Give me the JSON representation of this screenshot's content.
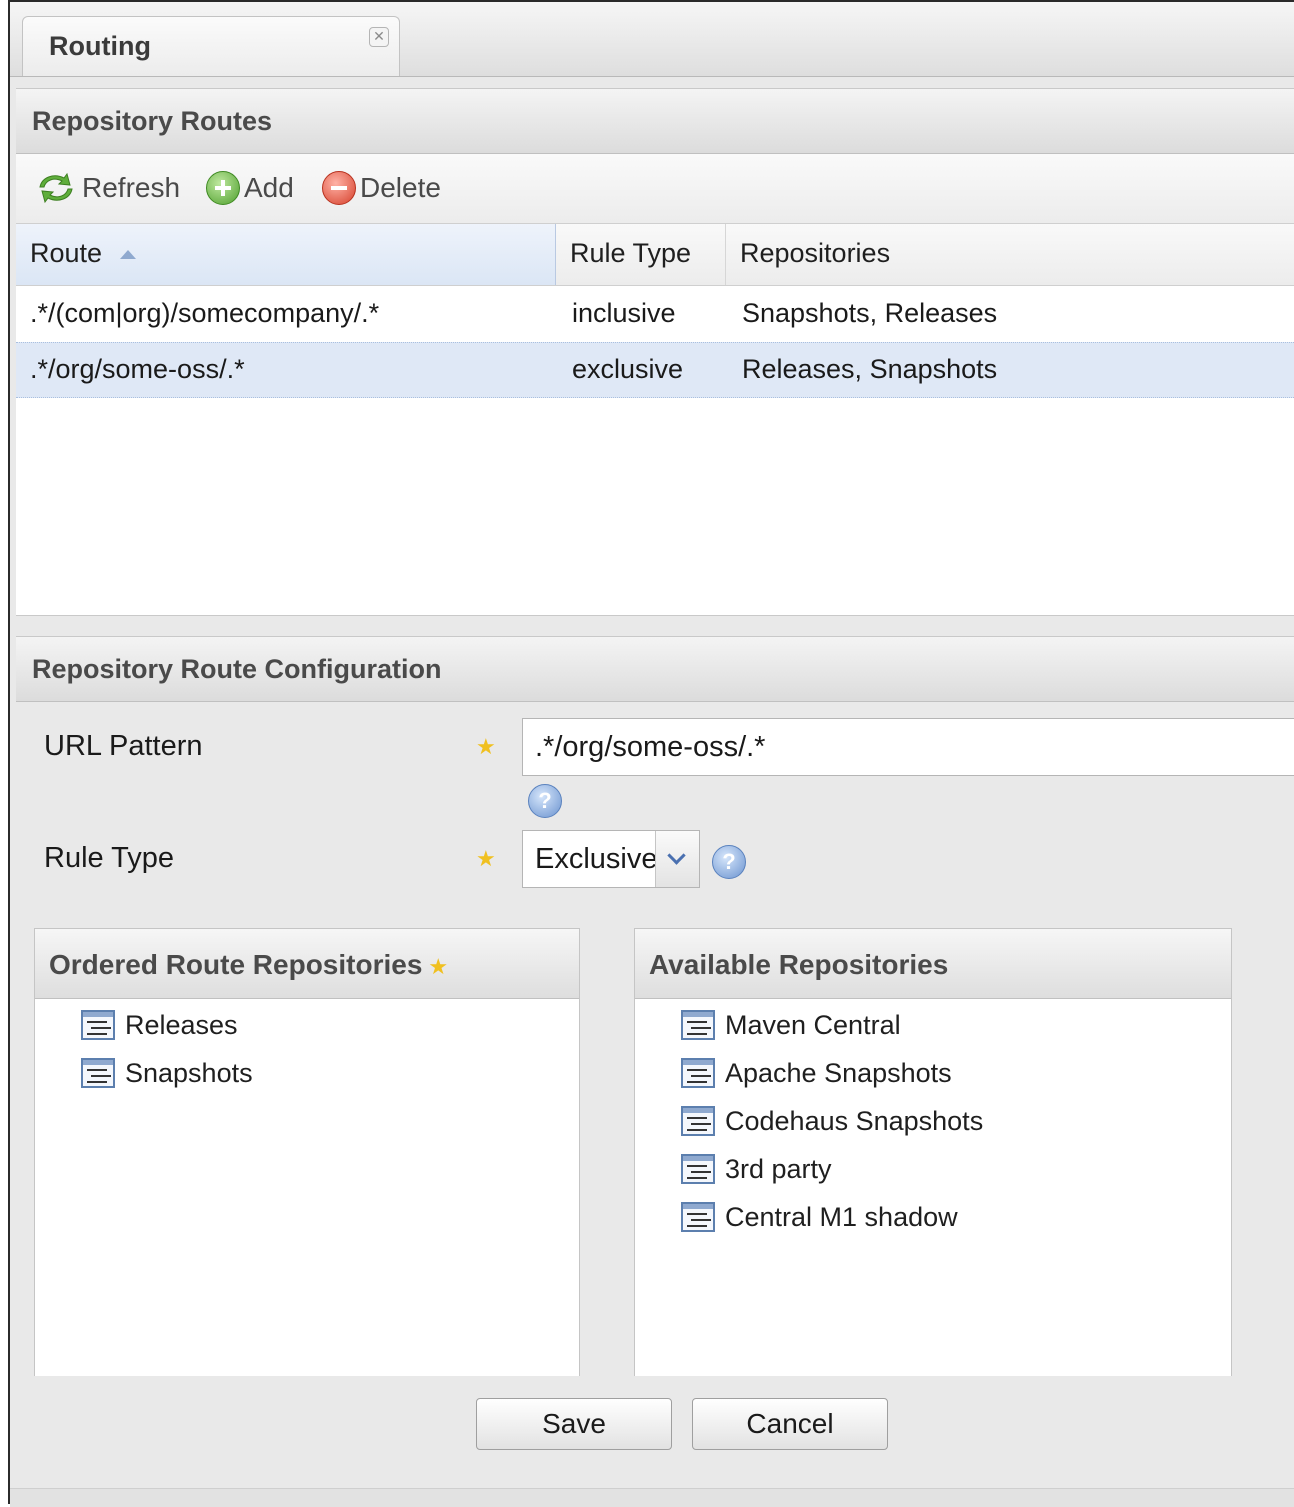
{
  "tab": {
    "title": "Routing",
    "close_symbol": "✕"
  },
  "routes_section": {
    "title": "Repository Routes"
  },
  "toolbar": {
    "refresh_label": "Refresh",
    "add_label": "Add",
    "delete_label": "Delete"
  },
  "grid": {
    "columns": [
      "Route",
      "Rule Type",
      "Repositories"
    ],
    "sorted_column": "Route",
    "sort_direction": "ascending",
    "rows": [
      {
        "route": ".*/(com|org)/somecompany/.*",
        "rule_type": "inclusive",
        "repositories": "Snapshots, Releases"
      },
      {
        "route": ".*/org/some-oss/.*",
        "rule_type": "exclusive",
        "repositories": "Releases, Snapshots"
      }
    ],
    "selected_row": 1
  },
  "config_section": {
    "title": "Repository Route Configuration"
  },
  "form": {
    "url_pattern_label": "URL Pattern",
    "url_pattern_value": ".*/org/some-oss/.*",
    "rule_type_label": "Rule Type",
    "rule_type_value": "Exclusive",
    "help_symbol": "?"
  },
  "ordered_panel": {
    "title": "Ordered Route Repositories",
    "items": [
      "Releases",
      "Snapshots"
    ]
  },
  "available_panel": {
    "title": "Available Repositories",
    "items": [
      "Maven Central",
      "Apache Snapshots",
      "Codehaus Snapshots",
      "3rd party",
      "Central M1 shadow"
    ]
  },
  "buttons": {
    "save_label": "Save",
    "cancel_label": "Cancel"
  },
  "icons": {
    "refresh": "refresh-icon",
    "add": "add-icon",
    "delete": "delete-icon",
    "help": "help-icon",
    "required": "required-star-icon",
    "repository": "repository-icon",
    "sort": "sort-asc-icon"
  },
  "colors": {
    "selected_row": "#dfe8f6",
    "required_star": "#f0c020",
    "header_text": "#4a4a4a"
  }
}
